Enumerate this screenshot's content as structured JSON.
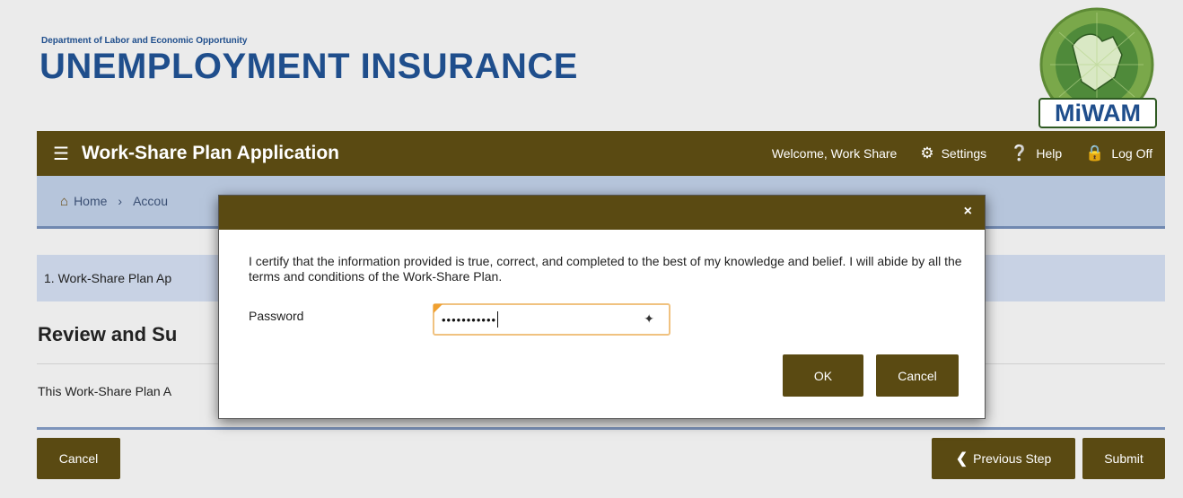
{
  "header": {
    "department": "Department of Labor and Economic Opportunity",
    "title": "UNEMPLOYMENT INSURANCE",
    "logo_text": "MiWAM"
  },
  "navbar": {
    "app_title": "Work-Share Plan Application",
    "welcome": "Welcome, Work Share",
    "settings": "Settings",
    "help": "Help",
    "logoff": "Log Off"
  },
  "breadcrumb": {
    "home": "Home",
    "accounts": "Accou"
  },
  "step": {
    "label": "1. Work-Share Plan Ap"
  },
  "section": {
    "title": "Review and Su",
    "description": "This Work-Share Plan A"
  },
  "footer": {
    "cancel": "Cancel",
    "previous": "Previous Step",
    "submit": "Submit"
  },
  "dialog": {
    "close": "×",
    "certify_text": "I certify that the information provided is true, correct, and completed to the best of my knowledge and belief. I will abide by all the terms and conditions of the Work-Share Plan.",
    "password_label": "Password",
    "password_value": "•••••••••••",
    "ok": "OK",
    "cancel": "Cancel"
  },
  "colors": {
    "brand_brown": "#5a4a12",
    "title_blue": "#1f4e8c",
    "breadcrumb_bg": "#b6c5db",
    "input_focus": "#f0c280"
  }
}
